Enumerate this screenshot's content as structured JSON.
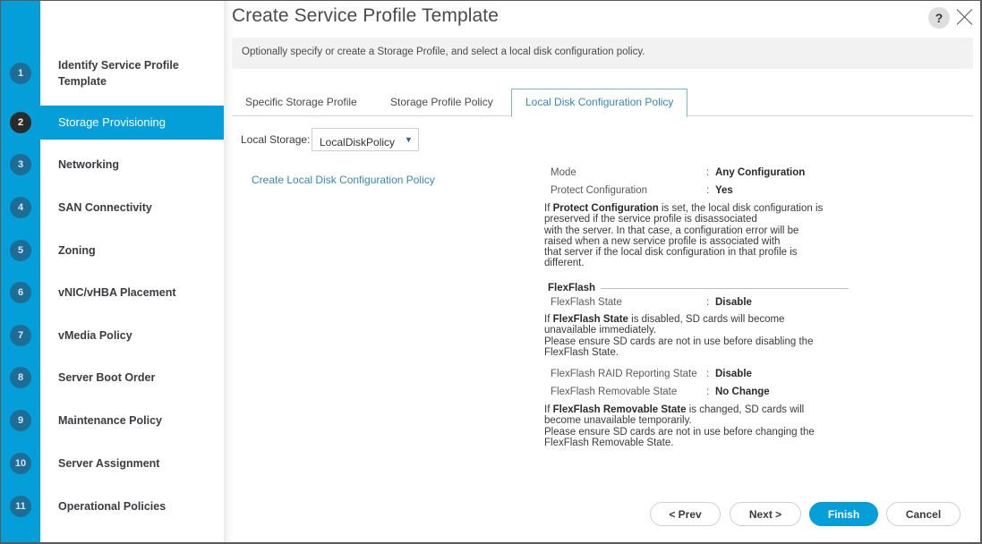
{
  "window": {
    "title": "Create Service Profile Template",
    "help_icon": "?",
    "close_icon": "close-icon"
  },
  "sidebar": {
    "steps": [
      {
        "num": "1",
        "label": "Identify Service Profile Template",
        "active": false
      },
      {
        "num": "2",
        "label": "Storage Provisioning",
        "active": true
      },
      {
        "num": "3",
        "label": "Networking",
        "active": false
      },
      {
        "num": "4",
        "label": "SAN Connectivity",
        "active": false
      },
      {
        "num": "5",
        "label": "Zoning",
        "active": false
      },
      {
        "num": "6",
        "label": "vNIC/vHBA Placement",
        "active": false
      },
      {
        "num": "7",
        "label": "vMedia Policy",
        "active": false
      },
      {
        "num": "8",
        "label": "Server Boot Order",
        "active": false
      },
      {
        "num": "9",
        "label": "Maintenance Policy",
        "active": false
      },
      {
        "num": "10",
        "label": "Server Assignment",
        "active": false
      },
      {
        "num": "11",
        "label": "Operational Policies",
        "active": false
      }
    ]
  },
  "main": {
    "description": "Optionally specify or create a Storage Profile, and select a local disk configuration policy.",
    "tabs": [
      {
        "label": "Specific Storage Profile",
        "active": false
      },
      {
        "label": "Storage Profile Policy",
        "active": false
      },
      {
        "label": "Local Disk Configuration Policy",
        "active": true
      }
    ],
    "local_storage": {
      "label": "Local Storage:",
      "value": "LocalDiskPolicy",
      "arrow": "▼"
    },
    "create_link": "Create Local Disk Configuration Policy",
    "details": {
      "separator": ":",
      "mode": {
        "key": "Mode",
        "value": "Any Configuration"
      },
      "protect": {
        "key": "Protect Configuration",
        "value": "Yes"
      },
      "protect_note": {
        "prefix": "If ",
        "bold": "Protect Configuration",
        "lines": [
          " is set, the local disk configuration is",
          "preserved if the service profile is disassociated",
          "with the server. In that case, a configuration error will be",
          "raised when a new service profile is associated with",
          "that server if the local disk configuration in that profile is",
          "different."
        ]
      },
      "flexflash_section": "FlexFlash",
      "flexflash_state": {
        "key": "FlexFlash State",
        "value": "Disable"
      },
      "flexflash_note": {
        "prefix": "If ",
        "bold": "FlexFlash State",
        "lines": [
          " is disabled, SD cards will become",
          "unavailable immediately.",
          "Please ensure SD cards are not in use before disabling the",
          "FlexFlash State."
        ]
      },
      "raid_state": {
        "key": "FlexFlash RAID Reporting State",
        "value": "Disable"
      },
      "removable_state": {
        "key": "FlexFlash Removable State",
        "value": "No Change"
      },
      "removable_note": {
        "prefix": "If ",
        "bold": "FlexFlash Removable State",
        "lines": [
          " is changed, SD cards will",
          "become unavailable temporarily.",
          "Please ensure SD cards are not in use before changing the",
          "FlexFlash Removable State."
        ]
      }
    }
  },
  "footer": {
    "prev": "< Prev",
    "next": "Next >",
    "finish": "Finish",
    "cancel": "Cancel"
  },
  "colors": {
    "accent": "#049fd9",
    "step_circle": "#1d6d97",
    "active_step_circle": "#2b2b2b",
    "link": "#3c86b0"
  }
}
